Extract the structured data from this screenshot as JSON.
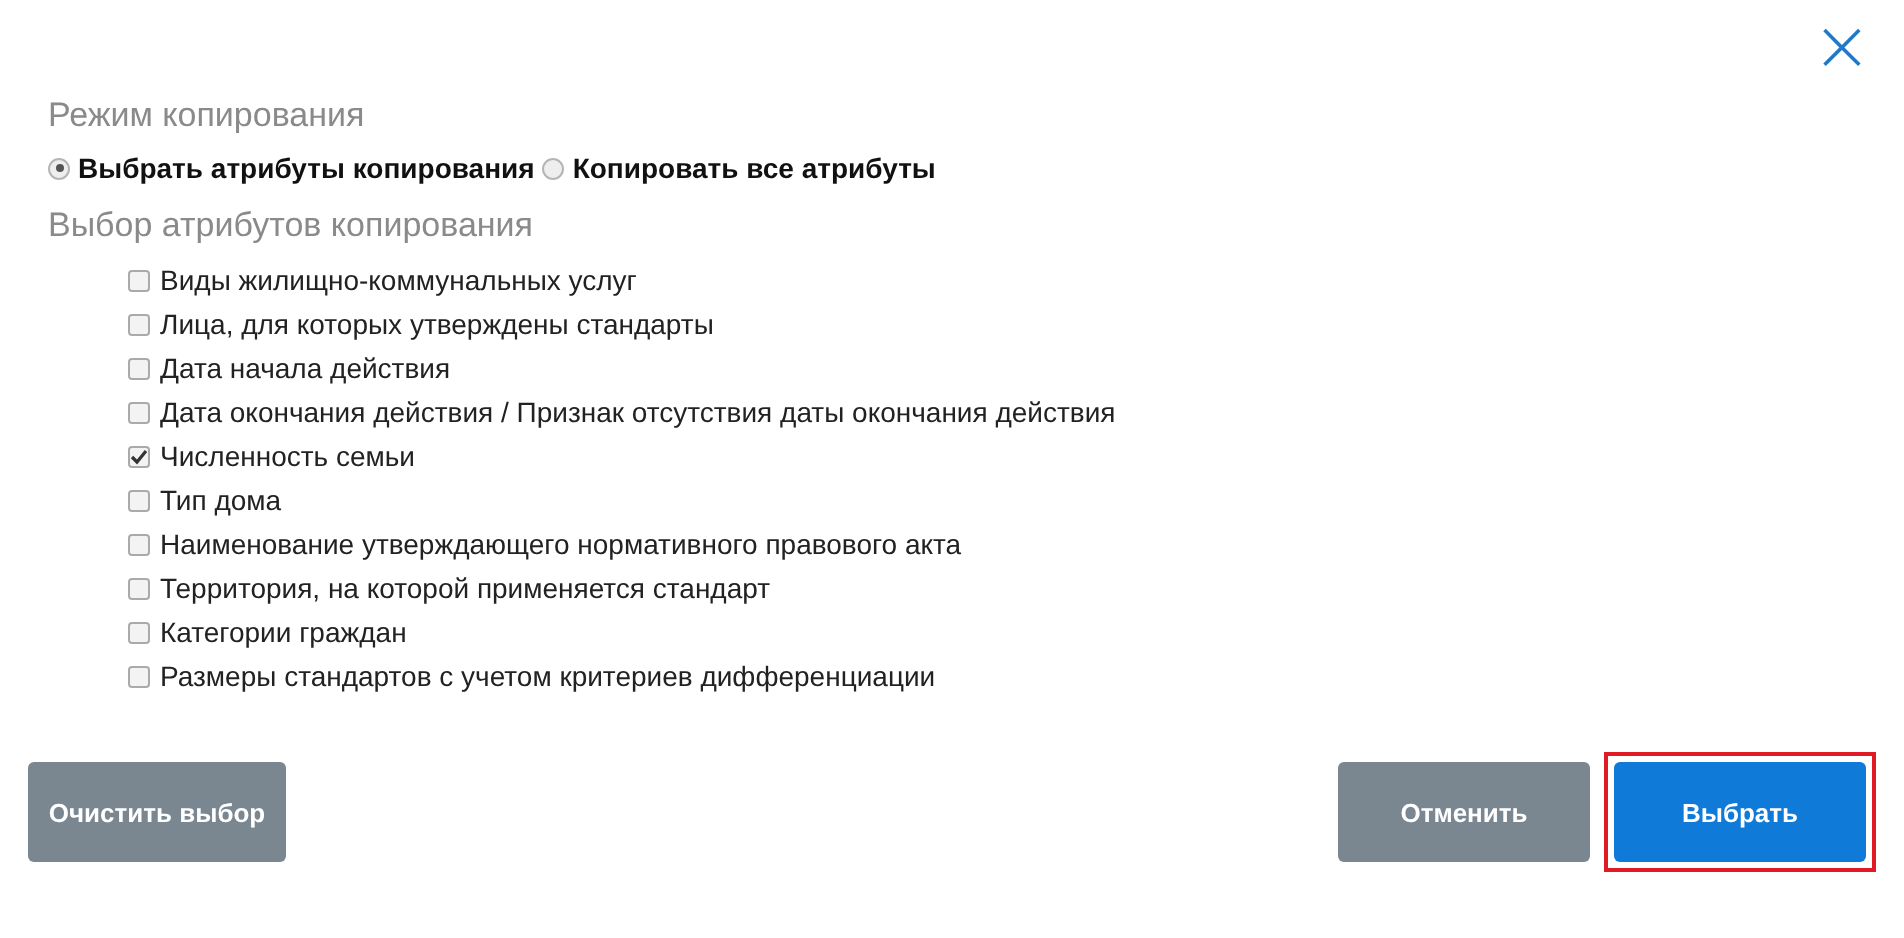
{
  "close_icon": "×",
  "mode": {
    "title": "Режим копирования",
    "options": [
      {
        "label": "Выбрать атрибуты копирования",
        "selected": true
      },
      {
        "label": "Копировать все атрибуты",
        "selected": false
      }
    ]
  },
  "attributes": {
    "title": "Выбор атрибутов копирования",
    "items": [
      {
        "label": "Виды жилищно-коммунальных услуг",
        "checked": false
      },
      {
        "label": "Лица, для которых утверждены стандарты",
        "checked": false
      },
      {
        "label": "Дата начала действия",
        "checked": false
      },
      {
        "label": "Дата окончания действия / Признак отсутствия даты окончания действия",
        "checked": false
      },
      {
        "label": "Численность семьи",
        "checked": true
      },
      {
        "label": "Тип дома",
        "checked": false
      },
      {
        "label": "Наименование утверждающего нормативного правового акта",
        "checked": false
      },
      {
        "label": "Территория, на которой применяется стандарт",
        "checked": false
      },
      {
        "label": "Категории граждан",
        "checked": false
      },
      {
        "label": "Размеры стандартов с учетом критериев дифференциации",
        "checked": false
      }
    ]
  },
  "buttons": [
    {
      "label": "Очистить выбор",
      "kind": "secondary",
      "highlighted": false
    },
    {
      "label": "Отменить",
      "kind": "secondary",
      "highlighted": false
    },
    {
      "label": "Выбрать",
      "kind": "primary",
      "highlighted": true
    }
  ]
}
